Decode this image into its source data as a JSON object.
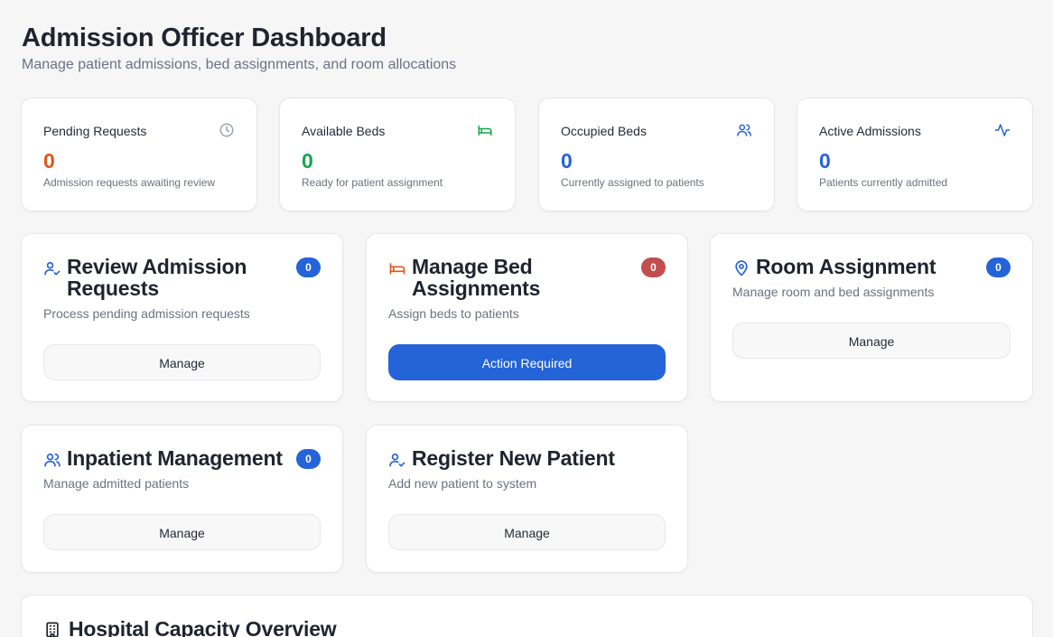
{
  "header": {
    "title": "Admission Officer Dashboard",
    "subtitle": "Manage patient admissions, bed assignments, and room allocations"
  },
  "stats": [
    {
      "label": "Pending Requests",
      "value": "0",
      "description": "Admission requests awaiting review",
      "icon": "clock-icon",
      "color": "#e0561b"
    },
    {
      "label": "Available Beds",
      "value": "0",
      "description": "Ready for patient assignment",
      "icon": "bed-icon",
      "color": "#16a34a"
    },
    {
      "label": "Occupied Beds",
      "value": "0",
      "description": "Currently assigned to patients",
      "icon": "users-icon",
      "color": "#2563d8"
    },
    {
      "label": "Active Admissions",
      "value": "0",
      "description": "Patients currently admitted",
      "icon": "activity-icon",
      "color": "#2563d8"
    }
  ],
  "actions": [
    {
      "title": "Review Admission Requests",
      "description": "Process pending admission requests",
      "badge": "0",
      "button": "Manage",
      "icon": "user-check-icon"
    },
    {
      "title": "Manage Bed Assignments",
      "description": "Assign beds to patients",
      "badge": "0",
      "button": "Action Required",
      "icon": "bed-icon"
    },
    {
      "title": "Room Assignment",
      "description": "Manage room and bed assignments",
      "badge": "0",
      "button": "Manage",
      "icon": "map-pin-icon"
    },
    {
      "title": "Inpatient Management",
      "description": "Manage admitted patients",
      "badge": "0",
      "button": "Manage",
      "icon": "users-icon"
    },
    {
      "title": "Register New Patient",
      "description": "Add new patient to system",
      "button": "Manage",
      "icon": "user-check-icon"
    }
  ],
  "overview": {
    "title": "Hospital Capacity Overview",
    "icon": "building-icon"
  },
  "colors": {
    "primary": "#2563d8",
    "danger_badge": "#c24d4d",
    "pending": "#e0561b",
    "available": "#16a34a"
  }
}
